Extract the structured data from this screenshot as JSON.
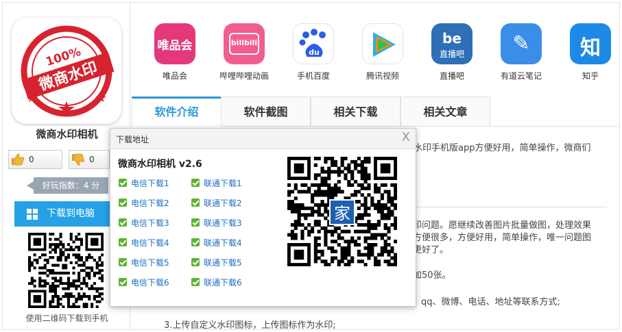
{
  "app": {
    "name": "微商水印相机",
    "logo_text_top": "100%",
    "logo_text_main": "微商水印",
    "likes": "0",
    "dislikes": "0",
    "score_label": "好玩指数：4 分",
    "pc_download_label": "下载到电脑",
    "scan_tip": "使用二维码下载到手机"
  },
  "related_apps": [
    {
      "label": "唯品会",
      "icon": "vipshop-icon",
      "color": "#e4387a",
      "glyph": "唯品会"
    },
    {
      "label": "哔哩哔哩动画",
      "icon": "bilibili-icon",
      "color": "#f25d8e",
      "glyph": "bilibili"
    },
    {
      "label": "手机百度",
      "icon": "baidu-icon",
      "color": "#ffffff",
      "glyph": "du"
    },
    {
      "label": "腾讯视频",
      "icon": "tencent-video-icon",
      "color": "#ffffff",
      "glyph": "▶"
    },
    {
      "label": "直播吧",
      "icon": "zhibo8-icon",
      "color": "#2f6fb8",
      "glyph": "直播吧"
    },
    {
      "label": "有道云笔记",
      "icon": "youdao-note-icon",
      "color": "#3a8ee8",
      "glyph": "✎"
    },
    {
      "label": "知乎",
      "icon": "zhihu-icon",
      "color": "#1e8ae8",
      "glyph": "知"
    }
  ],
  "tabs": [
    "软件介绍",
    "软件截图",
    "相关下载",
    "相关文章"
  ],
  "article": {
    "line1": "水印手机版app方便好用，简单操作，微商们",
    "line2": "印问题。愿继续改善图片批量做图，处理效果",
    "line3": "方便很多，方便好用，简单操作，唯一问题图",
    "line4": "更好了。",
    "line5": "加50张。",
    "line6": "qq、微博、电话、地址等联系方式;",
    "line7": "3.上传自定义水印图标，上传图标作为水印;"
  },
  "popup": {
    "title": "下载地址",
    "close": "X",
    "app_version": "微商水印相机 v2.6",
    "telecom_links": [
      "电信下载1",
      "电信下载2",
      "电信下载3",
      "电信下载4",
      "电信下载5",
      "电信下载6"
    ],
    "unicom_links": [
      "联通下载1",
      "联通下载2",
      "联通下载3",
      "联通下载4",
      "联通下载5",
      "联通下载6"
    ],
    "qr_badge": "家"
  },
  "colors": {
    "accent": "#2b98d4",
    "download_button": "#26a0e6",
    "link": "#1a6fc1",
    "check": "#5cb531"
  }
}
